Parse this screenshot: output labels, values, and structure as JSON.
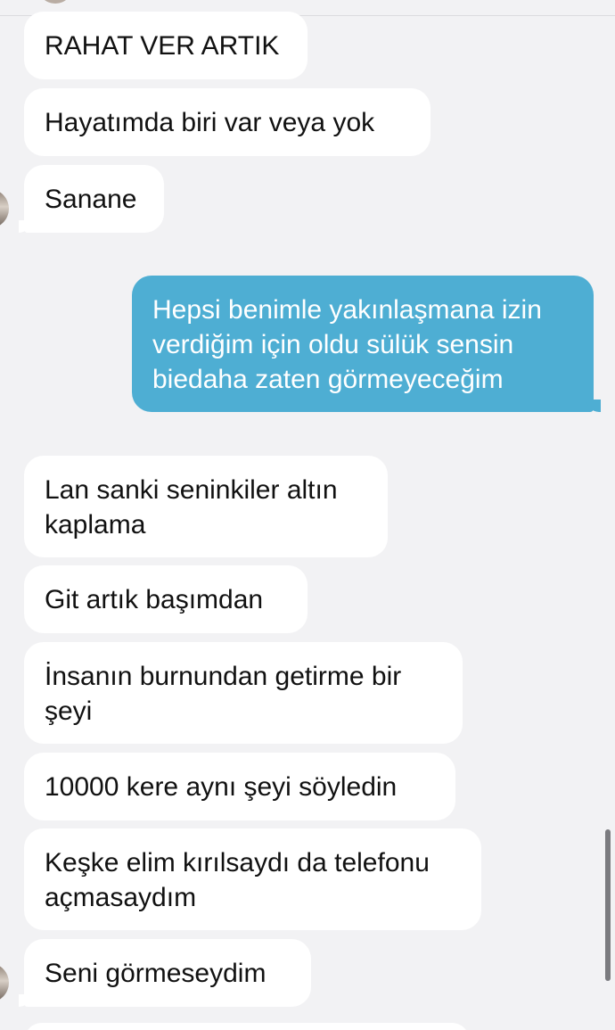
{
  "messages": [
    {
      "text": "RAHAT VER ARTIK",
      "direction": "incoming"
    },
    {
      "text": "Hayatımda biri var veya yok",
      "direction": "incoming"
    },
    {
      "text": "Sanane",
      "direction": "incoming"
    },
    {
      "text": "Hepsi benimle yakınlaşmana izin\nverdiğim için oldu sülük sensin\nbiedaha zaten görmeyeceğim",
      "direction": "outgoing"
    },
    {
      "text": "Lan sanki seninkiler altın\nkaplama",
      "direction": "incoming"
    },
    {
      "text": "Git artık başımdan",
      "direction": "incoming"
    },
    {
      "text": "İnsanın burnundan getirme bir\nşeyi",
      "direction": "incoming"
    },
    {
      "text": "10000 kere aynı şeyi söyledin",
      "direction": "incoming"
    },
    {
      "text": "Keşke elim kırılsaydı da telefonu\naçmasaydım",
      "direction": "incoming"
    },
    {
      "text": "Seni görmeseydim",
      "direction": "incoming"
    }
  ],
  "colors": {
    "background": "#f2f2f4",
    "incoming_bubble": "#ffffff",
    "outgoing_bubble": "#4eaed3",
    "incoming_text": "#111111",
    "outgoing_text": "#ffffff"
  }
}
